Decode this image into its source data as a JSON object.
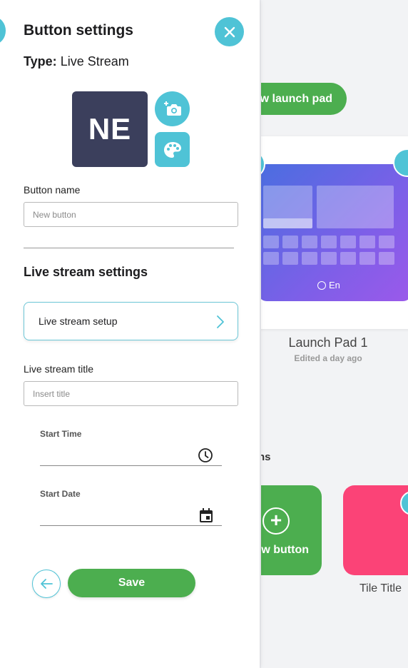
{
  "background": {
    "new_launchpad_label": "ew launch pad",
    "launchpad": {
      "lang": "En",
      "name": "Launch Pad 1",
      "edited": "Edited a day ago"
    },
    "section_fragment": "ns",
    "tiles": {
      "new_button_label": "w button",
      "tile_title": "Tile Title"
    }
  },
  "panel": {
    "title": "Button settings",
    "type_label": "Type:",
    "type_value": "Live Stream",
    "avatar_initials": "NE",
    "button_name_label": "Button name",
    "button_name_placeholder": "New button",
    "live_stream_section_title": "Live stream settings",
    "setup_label": "Live stream setup",
    "stream_title_label": "Live stream title",
    "stream_title_placeholder": "Insert title",
    "start_time_label": "Start Time",
    "start_date_label": "Start Date",
    "save_label": "Save"
  },
  "colors": {
    "accent": "#4fc3d6",
    "primary_green": "#4cae4f",
    "avatar_bg": "#3b3f5c",
    "tile_pink": "#fb4377"
  },
  "icons": [
    "close-icon",
    "camera-plus-icon",
    "palette-icon",
    "chevron-right-icon",
    "clock-icon",
    "calendar-icon",
    "arrow-left-icon",
    "globe-icon",
    "plus-icon"
  ]
}
